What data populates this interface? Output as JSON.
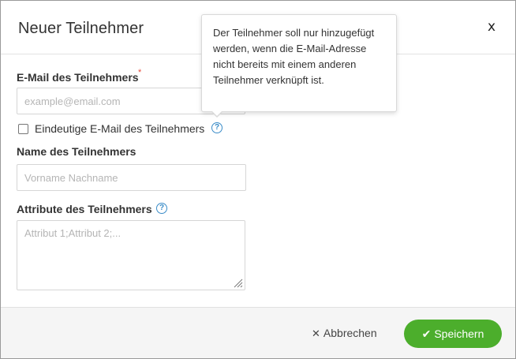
{
  "modal": {
    "title": "Neuer Teilnehmer",
    "close_label": "x"
  },
  "form": {
    "email": {
      "label": "E-Mail des Teilnehmers",
      "required_mark": "*",
      "placeholder": "example@email.com",
      "value": ""
    },
    "unique_email": {
      "label": "Eindeutige E-Mail des Teilnehmers",
      "checked": false
    },
    "name": {
      "label": "Name des Teilnehmers",
      "placeholder": "Vorname Nachname",
      "value": ""
    },
    "attributes": {
      "label": "Attribute des Teilnehmers",
      "placeholder": "Attribut 1;Attribut 2;...",
      "value": ""
    }
  },
  "tooltip": {
    "text": "Der Teilnehmer soll nur hinzugefügt werden, wenn die E-Mail-Adresse nicht bereits mit einem anderen Teilnehmer verknüpft ist."
  },
  "icons": {
    "help": "help-icon",
    "close": "close-icon",
    "cancel": "times-icon",
    "save": "check-icon"
  },
  "footer": {
    "cancel_label": "Abbrechen",
    "save_label": "Speichern"
  },
  "colors": {
    "accent_green": "#4cae2c",
    "help_blue": "#3a8cc8",
    "required_red": "#e74c3c"
  }
}
